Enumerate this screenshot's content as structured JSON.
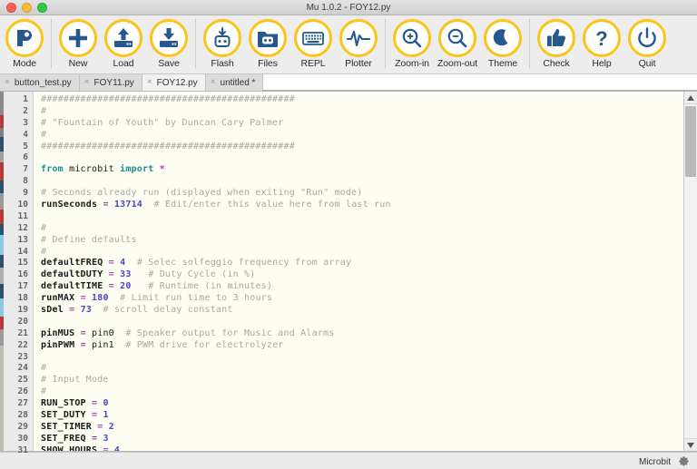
{
  "window": {
    "title": "Mu 1.0.2 - FOY12.py",
    "controls": [
      "close",
      "minimize",
      "zoom"
    ]
  },
  "toolbar": {
    "groups": [
      {
        "buttons": [
          {
            "label": "Mode",
            "icon": "mode-icon"
          }
        ]
      },
      {
        "buttons": [
          {
            "label": "New",
            "icon": "plus-icon"
          },
          {
            "label": "Load",
            "icon": "upload-icon"
          },
          {
            "label": "Save",
            "icon": "download-icon"
          }
        ]
      },
      {
        "buttons": [
          {
            "label": "Flash",
            "icon": "flash-robot-icon"
          },
          {
            "label": "Files",
            "icon": "folder-robot-icon"
          },
          {
            "label": "REPL",
            "icon": "keyboard-icon"
          },
          {
            "label": "Plotter",
            "icon": "waveform-icon"
          }
        ]
      },
      {
        "buttons": [
          {
            "label": "Zoom-in",
            "icon": "magnifier-plus-icon"
          },
          {
            "label": "Zoom-out",
            "icon": "magnifier-minus-icon"
          },
          {
            "label": "Theme",
            "icon": "moon-icon"
          }
        ]
      },
      {
        "buttons": [
          {
            "label": "Check",
            "icon": "thumbs-up-icon"
          },
          {
            "label": "Help",
            "icon": "question-mark-icon"
          },
          {
            "label": "Quit",
            "icon": "power-icon"
          }
        ]
      }
    ]
  },
  "tabs": [
    {
      "label": "button_test.py",
      "active": false,
      "close": "×"
    },
    {
      "label": "FOY11.py",
      "active": false,
      "close": "×"
    },
    {
      "label": "FOY12.py",
      "active": true,
      "close": "×"
    },
    {
      "label": "untitled *",
      "active": false,
      "close": "×"
    }
  ],
  "editor": {
    "first_line": 1,
    "last_line": 31,
    "line_numbers": [
      1,
      2,
      3,
      4,
      5,
      6,
      7,
      8,
      9,
      10,
      11,
      12,
      13,
      14,
      15,
      16,
      17,
      18,
      19,
      20,
      21,
      22,
      23,
      24,
      25,
      26,
      27,
      28,
      29,
      30,
      31
    ],
    "lines": [
      "#############################################",
      "#",
      "# \"Fountain of Youth\" by Duncan Cary Palmer",
      "#",
      "#############################################",
      "",
      "from microbit import *",
      "",
      "# Seconds already run (displayed when exiting \"Run\" mode)",
      "runSeconds = 13714  # Edit/enter this value here from last run",
      "",
      "#",
      "# Define defaults",
      "#",
      "defaultFREQ = 4  # Selec solfeggio frequency from array",
      "defaultDUTY = 33   # Duty Cycle (in %)",
      "defaultTIME = 20   # Runtime (in minutes)",
      "runMAX = 180  # Limit run time to 3 hours",
      "sDel = 73  # scroll delay constant",
      "",
      "pinMUS = pin0  # Speaker output for Music and Alarms",
      "pinPWM = pin1  # PWM drive for electrolyzer",
      "",
      "#",
      "# Input Mode",
      "#",
      "RUN_STOP = 0",
      "SET_DUTY = 1",
      "SET_TIMER = 2",
      "SET_FREQ = 3",
      "SHOW_HOURS = 4"
    ]
  },
  "scrollbar": {
    "up_arrow": "▲",
    "down_arrow": "▼"
  },
  "statusbar": {
    "mode": "Microbit",
    "gear_icon": "gear-icon"
  },
  "colors": {
    "accent_yellow": "#fcc319",
    "icon_blue": "#26578f",
    "editor_bg": "#fdfdf2",
    "comment": "#a9a9a0",
    "keyword": "#1e8f8f",
    "number": "#4a45c9",
    "operator": "#a04ca0"
  }
}
